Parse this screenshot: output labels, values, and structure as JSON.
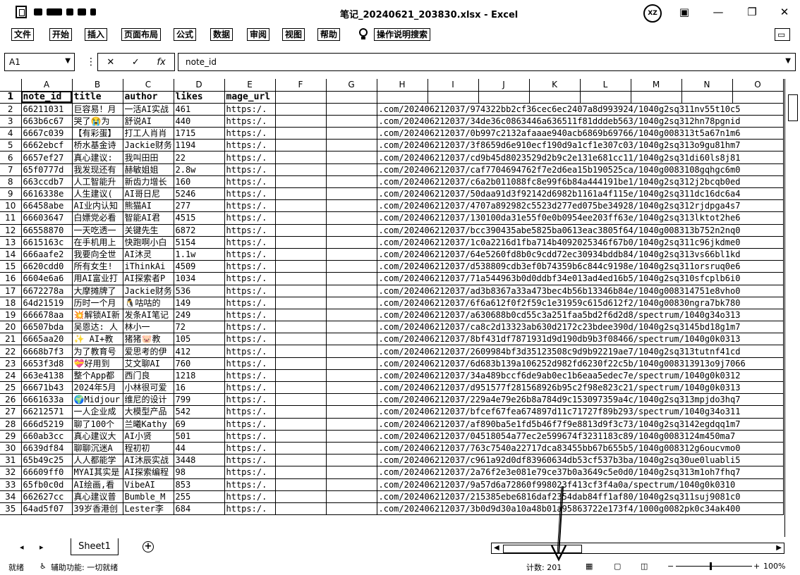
{
  "window": {
    "title": "笔记_20240621_203830.xlsx - Excel",
    "avatar_initials": "XZ"
  },
  "menu": [
    "文件",
    "开始",
    "插入",
    "页面布局",
    "公式",
    "数据",
    "审阅",
    "视图",
    "帮助",
    "操作说明搜索"
  ],
  "formula_bar": {
    "name_box": "A1",
    "content": "note_id"
  },
  "columns": [
    "A",
    "B",
    "C",
    "D",
    "E",
    "F",
    "G",
    "H",
    "I",
    "J",
    "K",
    "L",
    "M",
    "N",
    "O"
  ],
  "header_row": [
    "note_id",
    "title",
    "author",
    "likes",
    "mage_url"
  ],
  "rows": [
    {
      "n": "2",
      "a": "66211031",
      "b": "巨容易！月",
      "c": "一活AI实战",
      "d": "461",
      "e": "https:/.",
      "h": ".com/202406212037/974322bb2cf36cec6ec2407a8d993924/1040g2sq311nv55t10c5"
    },
    {
      "n": "3",
      "a": "663b6c67",
      "b": "哭了😭为",
      "c": "舒说AI",
      "d": "440",
      "e": "https:/.",
      "h": ".com/202406212037/34de36c0863446a636511f81dddeb563/1040g2sq312hn78pgnid"
    },
    {
      "n": "4",
      "a": "6667c039",
      "b": "【有彩蛋】",
      "c": "打工人肖肖",
      "d": "1715",
      "e": "https:/.",
      "h": ".com/202406212037/0b997c2132afaaae940acb6869b69766/1040g008313t5a67n1m6"
    },
    {
      "n": "5",
      "a": "6662ebcf",
      "b": "桥水基金诗",
      "c": "Jackie财务",
      "d": "1194",
      "e": "https:/.",
      "h": ".com/202406212037/3f8659d6e910ecf190d9a1cf1e307c03/1040g2sq313o9gu81hm7"
    },
    {
      "n": "6",
      "a": "6657ef27",
      "b": "真心建议:",
      "c": "我叫田田",
      "d": "22",
      "e": "https:/.",
      "h": ".com/202406212037/cd9b45d8023529d2b9c2e131e681cc11/1040g2sq31di60ls8j81"
    },
    {
      "n": "7",
      "a": "65f0777d",
      "b": "我发现还有",
      "c": "赫敏姐姐",
      "d": "2.8w",
      "e": "https:/.",
      "h": ".com/202406212037/caf7704694762f7e2d6ea15b190525ca/1040g0083108gqhgc6m0"
    },
    {
      "n": "8",
      "a": "663ccdb7",
      "b": "人工智能升",
      "c": "新齿力增长",
      "d": "160",
      "e": "https:/.",
      "h": ".com/202406212037/c6a2b011088fc8e99f6b84a444191be1/1040g2sq312j2bcqb0ed"
    },
    {
      "n": "9",
      "a": "6616338e",
      "b": "人生建议(",
      "c": "AI哥日尼",
      "d": "5246",
      "e": "https:/.",
      "h": ".com/202406212037/50daa91d3f92142d6982b1161a4f115e/1040g2sq311dc16dc6a4"
    },
    {
      "n": "10",
      "a": "66458abe",
      "b": "AI业内认知",
      "c": "熊猫AI",
      "d": "277",
      "e": "https:/.",
      "h": ".com/202406212037/4707a892982c5523d277ed075be34928/1040g2sq312rjdpga4s7"
    },
    {
      "n": "11",
      "a": "66603647",
      "b": "白嫖党必看",
      "c": "智能AI君",
      "d": "4515",
      "e": "https:/.",
      "h": ".com/202406212037/130100da31e55f0e0b0954ee203ff63e/1040g2sq313lktot2he6"
    },
    {
      "n": "12",
      "a": "66558870",
      "b": "一天吃透一",
      "c": "关键先生",
      "d": "6872",
      "e": "https:/.",
      "h": ".com/202406212037/bcc390435abe5825ba0613eac3805f64/1040g008313b752n2nq0"
    },
    {
      "n": "13",
      "a": "6615163c",
      "b": "在手机用上",
      "c": "快跑啊小白",
      "d": "5154",
      "e": "https:/.",
      "h": ".com/202406212037/1c0a2216d1fba714b4092025346f67b0/1040g2sq311c96jkdme0"
    },
    {
      "n": "14",
      "a": "666aafe2",
      "b": "我要向全世",
      "c": "AI沐灵",
      "d": "1.1w",
      "e": "https:/.",
      "h": ".com/202406212037/64e5260fd8b0c9cdd72ec30934bddb84/1040g2sq313vs66bl1kd"
    },
    {
      "n": "15",
      "a": "6620cdd0",
      "b": "所有女生!",
      "c": "iThinkAi",
      "d": "4509",
      "e": "https:/.",
      "h": ".com/202406212037/d538809cdb3ef0b74359b6c844c9198e/1040g2sq311orsruq0e6"
    },
    {
      "n": "16",
      "a": "6604e6a6",
      "b": "用AI富业打",
      "c": "AI探索者P",
      "d": "1034",
      "e": "https:/.",
      "h": ".com/202406212037/71a544963b0d0ddbf34e013ad4ed16b5/1040g2sq310sfcplb6i0"
    },
    {
      "n": "17",
      "a": "6672278a",
      "b": "大摩摊牌了",
      "c": "Jackie财务",
      "d": "536",
      "e": "https:/.",
      "h": ".com/202406212037/ad3b8367a33a473bec4b56b13346b84e/1040g008314751e8vho0"
    },
    {
      "n": "18",
      "a": "64d21519",
      "b": "历时一个月",
      "c": "🐧咕咕的",
      "d": "149",
      "e": "https:/.",
      "h": ".com/202406212037/6f6a612f0f2f59c1e31959c615d612f2/1040g00830ngra7bk780"
    },
    {
      "n": "19",
      "a": "666678aa",
      "b": "💥解锁AI新",
      "c": "发条AI笔记",
      "d": "249",
      "e": "https:/.",
      "h": ".com/202406212037/a630688b0cd55c3a251faa5bd2f6d2d8/spectrum/1040g34o313"
    },
    {
      "n": "20",
      "a": "66507bda",
      "b": "吴恩达: 人",
      "c": "林小一",
      "d": "72",
      "e": "https:/.",
      "h": ".com/202406212037/ca8c2d13323ab630d2172c23bdee390d/1040g2sq3145bd18g1m7"
    },
    {
      "n": "21",
      "a": "6665aa20",
      "b": "✨ AI+教",
      "c": "猪猪🐷教",
      "d": "105",
      "e": "https:/.",
      "h": ".com/202406212037/8bf431df7871931d9d190db9b3f08466/spectrum/1040g0k0313"
    },
    {
      "n": "22",
      "a": "6668b7f3",
      "b": "为了教育号",
      "c": "爱思考的伊",
      "d": "412",
      "e": "https:/.",
      "h": ".com/202406212037/2609984bf3d35123508c9d9b92219ae7/1040g2sq313tutnf41cd"
    },
    {
      "n": "23",
      "a": "6653f3d8",
      "b": "💝好用到",
      "c": "艾文聊AI",
      "d": "760",
      "e": "https:/.",
      "h": ".com/202406212037/6d683b139a106252d982fd6230f22c5b/1040g008313913o9j7066"
    },
    {
      "n": "24",
      "a": "663e4138",
      "b": "整个App都",
      "c": "西门良",
      "d": "1218",
      "e": "https:/.",
      "h": ".com/202406212037/34a489bccf6de9ab0ec1b6eaa5edec7e/spectrum/1040g0k0312"
    },
    {
      "n": "25",
      "a": "66671b43",
      "b": "2024年5月",
      "c": "小林很可爱",
      "d": "16",
      "e": "https:/.",
      "h": ".com/202406212037/d951577f281568926b95c2f98e823c21/spectrum/1040g0k0313"
    },
    {
      "n": "26",
      "a": "6661633a",
      "b": "🌍Midjour",
      "c": "维尼的设计",
      "d": "799",
      "e": "https:/.",
      "h": ".com/202406212037/229a4e79e26b8a784d9c153097359a4c/1040g2sq313mpjdo3hq7"
    },
    {
      "n": "27",
      "a": "66212571",
      "b": "一人企业成",
      "c": "大模型产品",
      "d": "542",
      "e": "https:/.",
      "h": ".com/202406212037/bfcef67fea674897d11c71727f89b293/spectrum/1040g34o311"
    },
    {
      "n": "28",
      "a": "666d5219",
      "b": "聊了100个",
      "c": "兰曦Kathy",
      "d": "69",
      "e": "https:/.",
      "h": ".com/202406212037/af890ba5e1fd5b46f7f9e8813d9f3c73/1040g2sq3142egdqq1m7"
    },
    {
      "n": "29",
      "a": "660ab3cc",
      "b": "真心建议大",
      "c": "AI小贤",
      "d": "501",
      "e": "https:/.",
      "h": ".com/202406212037/04518054a77ec2e599674f3231183c89/1040g0083124m450ma7"
    },
    {
      "n": "30",
      "a": "6639df84",
      "b": "聊聊沉迷A",
      "c": "程初初",
      "d": "44",
      "e": "https:/.",
      "h": ".com/202406212037/763c7540a22717dca83455bb67b655b5/1040g008312g6oucvmo0"
    },
    {
      "n": "31",
      "a": "65b49c25",
      "b": "人人都能学",
      "c": "AI沐辰实战",
      "d": "3448",
      "e": "https:/.",
      "h": ".com/202406212037/c961a92d0df83960634db53cf537b3ba/1040g2sq30ue0luabli5"
    },
    {
      "n": "32",
      "a": "66609ff0",
      "b": "MYAI其实是",
      "c": "AI探索编程",
      "d": "98",
      "e": "https:/.",
      "h": ".com/202406212037/2a76f2e3e081e79ce37b0a3649c5e0d0/1040g2sq313m1oh7fhq7"
    },
    {
      "n": "33",
      "a": "65fb0c0d",
      "b": "AI绘画,看",
      "c": "VibeAI",
      "d": "853",
      "e": "https:/.",
      "h": ".com/202406212037/9a57d6a72860f998023f413cf3f4a0a/spectrum/1040g0k0310"
    },
    {
      "n": "34",
      "a": "662627cc",
      "b": "真心建议普",
      "c": "Bumble_M",
      "d": "255",
      "e": "https:/.",
      "h": ".com/202406212037/215385ebe6816daf2354dab84ff1af80/1040g2sq311suj9081c0"
    },
    {
      "n": "35",
      "a": "64ad5f07",
      "b": "39岁香港创",
      "c": "Lester李",
      "d": "684",
      "e": "https:/.",
      "h": ".com/202406212037/3b0d9d30a10a48b01a95863722e173f4/1000g0082pk0c34ak400"
    }
  ],
  "sheet_tab": "Sheet1",
  "status": {
    "ready": "就绪",
    "accessibility": "辅助功能: 一切就绪",
    "count": "计数: 201",
    "zoom": "100%"
  }
}
